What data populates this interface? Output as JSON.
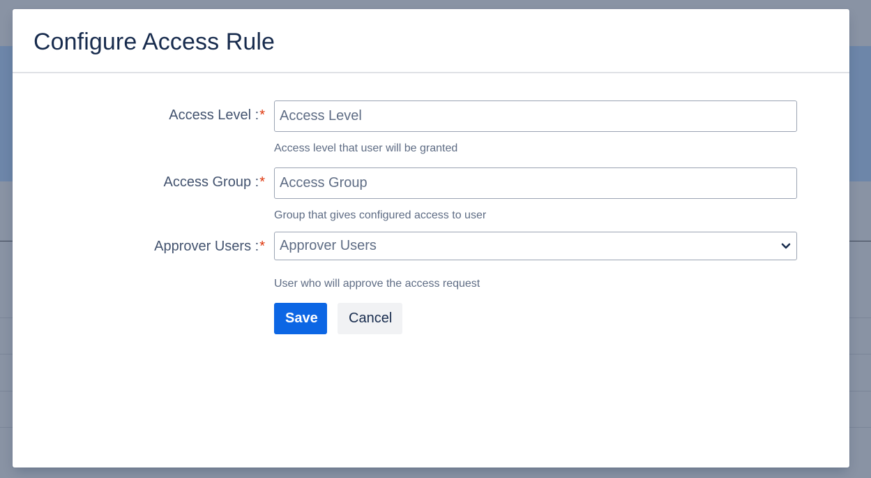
{
  "modal": {
    "title": "Configure Access Rule"
  },
  "form": {
    "required_mark": "*",
    "access_level": {
      "label": "Access Level :",
      "placeholder": "Access Level",
      "value": "",
      "help": "Access level that user will be granted"
    },
    "access_group": {
      "label": "Access Group :",
      "placeholder": "Access Group",
      "value": "",
      "help": "Group that gives configured access to user"
    },
    "approver_users": {
      "label": "Approver Users :",
      "placeholder": "Approver Users",
      "help": "User who will approve the access request",
      "icon": "chevron-down-icon"
    }
  },
  "actions": {
    "save_label": "Save",
    "cancel_label": "Cancel"
  },
  "colors": {
    "primary": "#0c66e4",
    "required": "#de350b",
    "text": "#172b4d",
    "overlay": "#8993a4"
  }
}
